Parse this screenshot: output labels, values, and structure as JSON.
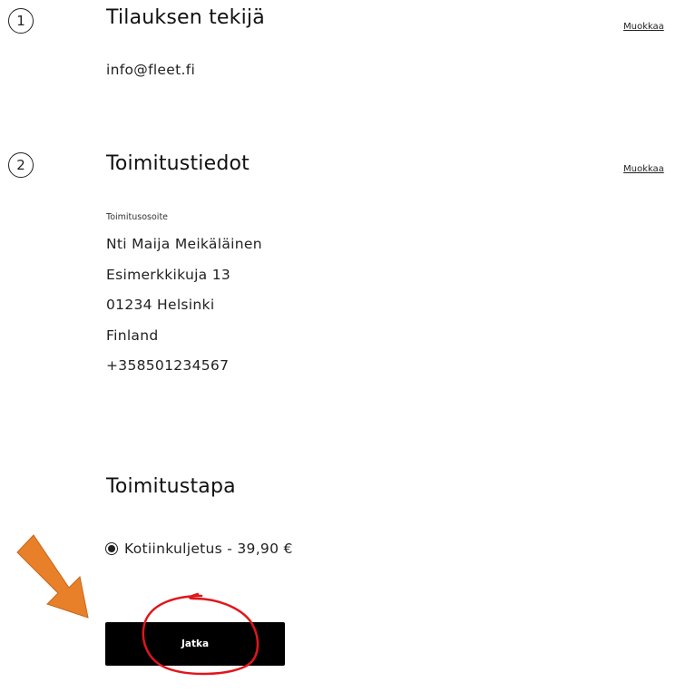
{
  "orderer": {
    "step_number": "1",
    "title": "Tilauksen tekijä",
    "edit_label": "Muokkaa",
    "email": "info@fleet.fi"
  },
  "delivery": {
    "step_number": "2",
    "title": "Toimitustiedot",
    "edit_label": "Muokkaa",
    "address_label": "Toimitusosoite",
    "address_lines": [
      "Nti Maija Meikäläinen",
      "Esimerkkikuja 13",
      "01234 Helsinki",
      "Finland",
      "+358501234567"
    ]
  },
  "shipping": {
    "title": "Toimitustapa",
    "option_label": "Kotiinkuljetus - 39,90 €",
    "option_selected": true
  },
  "actions": {
    "continue_label": "Jatka"
  },
  "annotations": {
    "arrow_color": "#e8802a",
    "circle_color": "#e0161b"
  }
}
